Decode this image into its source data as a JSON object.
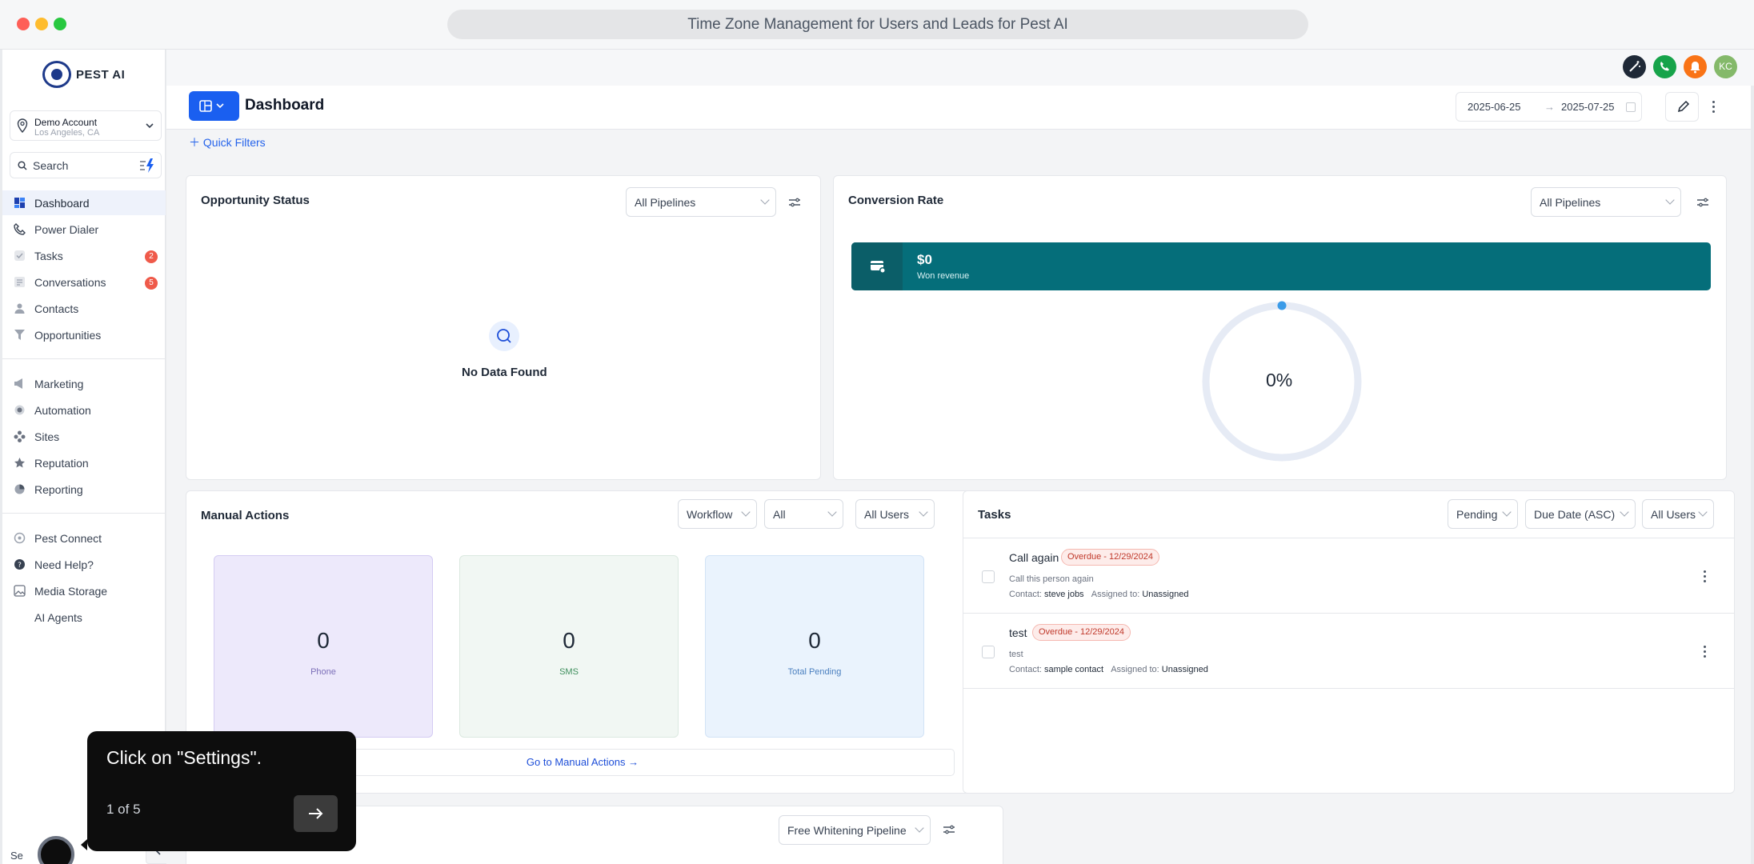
{
  "window": {
    "title": "Time Zone Management for Users and Leads for Pest AI"
  },
  "brand": {
    "logo_text": "PEST AI",
    "accent": "#1a5ff0"
  },
  "account": {
    "name": "Demo Account",
    "location": "Los Angeles, CA"
  },
  "search": {
    "placeholder": "Search"
  },
  "sidebar": {
    "primary": [
      {
        "label": "Dashboard",
        "icon": "dashboard-icon"
      },
      {
        "label": "Power Dialer",
        "icon": "phone-icon"
      },
      {
        "label": "Tasks",
        "icon": "check-icon",
        "badge": "2"
      },
      {
        "label": "Conversations",
        "icon": "chat-icon",
        "badge": "5"
      },
      {
        "label": "Contacts",
        "icon": "person-icon"
      },
      {
        "label": "Opportunities",
        "icon": "funnel-icon"
      }
    ],
    "secondary": [
      {
        "label": "Marketing",
        "icon": "megaphone-icon"
      },
      {
        "label": "Automation",
        "icon": "automation-icon"
      },
      {
        "label": "Sites",
        "icon": "sites-icon"
      },
      {
        "label": "Reputation",
        "icon": "star-icon"
      },
      {
        "label": "Reporting",
        "icon": "pie-icon"
      }
    ],
    "tertiary": [
      {
        "label": "Pest Connect",
        "icon": "connect-icon"
      },
      {
        "label": "Need Help?",
        "icon": "help-icon"
      },
      {
        "label": "Media Storage",
        "icon": "image-icon"
      },
      {
        "label": "AI Agents",
        "icon": ""
      }
    ],
    "settings_partial": "Se"
  },
  "topbar": {
    "avatar_initials": "KC"
  },
  "header": {
    "title": "Dashboard",
    "date_start": "2025-06-25",
    "date_arrow": "→",
    "date_end": "2025-07-25"
  },
  "quick_filters": "Quick Filters",
  "opportunity_status": {
    "title": "Opportunity Status",
    "pipeline": "All Pipelines",
    "empty": "No Data Found"
  },
  "conversion_rate": {
    "title": "Conversion Rate",
    "pipeline": "All Pipelines",
    "revenue_value": "$0",
    "revenue_label": "Won revenue",
    "percent": "0%",
    "percent_value": 0
  },
  "manual_actions": {
    "title": "Manual Actions",
    "filters": [
      "Workflow",
      "All",
      "All Users"
    ],
    "tiles": [
      {
        "value": "0",
        "label": "Phone"
      },
      {
        "value": "0",
        "label": "SMS"
      },
      {
        "value": "0",
        "label": "Total Pending"
      }
    ],
    "link": "Go to Manual Actions →"
  },
  "tasks": {
    "title": "Tasks",
    "filters": [
      "Pending",
      "Due Date (ASC)",
      "All Users"
    ],
    "items": [
      {
        "title": "Call again",
        "badge": "Overdue - 12/29/2024",
        "desc": "Call this person again",
        "contact_label": "Contact:",
        "contact": "steve jobs",
        "assigned_label": "Assigned to:",
        "assigned": "Unassigned"
      },
      {
        "title": "test",
        "badge": "Overdue - 12/29/2024",
        "desc": "test",
        "contact_label": "Contact:",
        "contact": "sample contact",
        "assigned_label": "Assigned to:",
        "assigned": "Unassigned"
      }
    ]
  },
  "pipeline_card": {
    "pipeline": "Free Whitening Pipeline"
  },
  "tour": {
    "message": "Click on \"Settings\".",
    "step": "1 of 5"
  }
}
